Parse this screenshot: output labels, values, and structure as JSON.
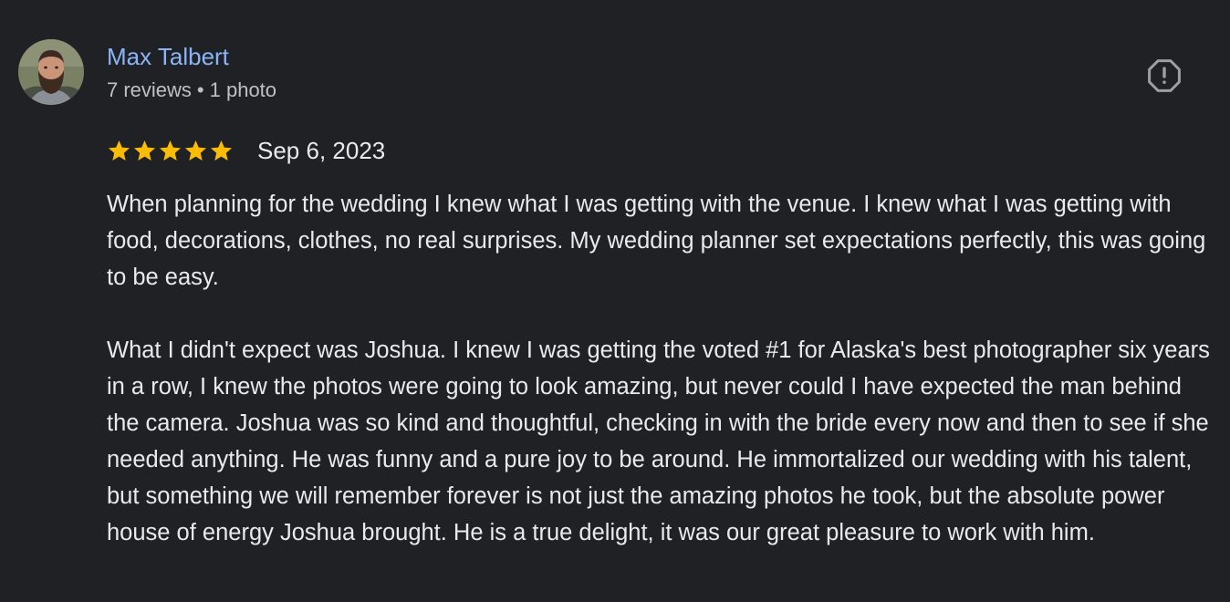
{
  "author": {
    "name": "Max Talbert",
    "reviews": "7 reviews",
    "separator": "•",
    "photos": "1 photo",
    "avatar_icon": "user-avatar-photo"
  },
  "actions": {
    "report_icon": "alert-circle-icon"
  },
  "rating": {
    "stars": 5,
    "max_stars": 5,
    "star_color": "#fbbc04"
  },
  "review": {
    "date": "Sep 6, 2023",
    "text": "When planning for the wedding I knew what I was getting with the venue. I knew what I was getting with food, decorations, clothes, no real surprises. My wedding planner set expectations perfectly, this was going to be easy.\n\nWhat I didn't expect was Joshua. I knew I was getting the voted #1 for Alaska's best photographer six years in a row, I knew the photos were going to look amazing, but never could I have expected the man behind the camera. Joshua was so kind and thoughtful, checking in with the bride every now and then to see if she needed anything. He was funny and a pure joy to be around. He immortalized our wedding with his talent, but something we will remember forever is not just the amazing photos he took, but the absolute power house of energy Joshua brought. He is a true delight, it was our great pleasure to work with him."
  },
  "colors": {
    "background": "#202124",
    "name_link": "#8ab4f8",
    "primary_text": "#e8eaed",
    "secondary_text": "#bdc1c6",
    "icon": "#9aa0a6"
  }
}
